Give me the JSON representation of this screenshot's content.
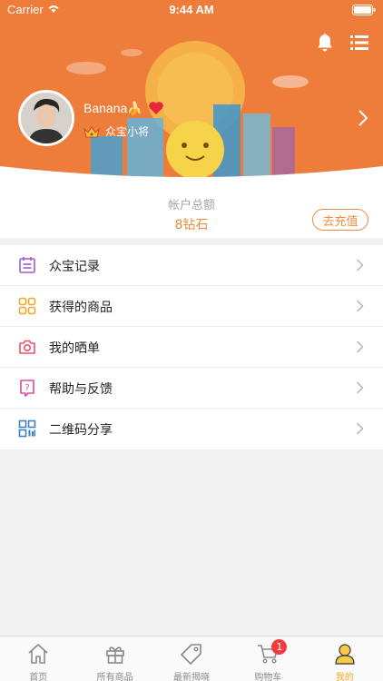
{
  "status_bar": {
    "carrier": "Carrier",
    "time": "9:44 AM"
  },
  "profile": {
    "username": "Banana🍌",
    "rank": "众宝小将"
  },
  "account": {
    "label": "帐户总额",
    "value": "8钻石",
    "recharge_label": "去充值"
  },
  "menu": {
    "items": [
      {
        "label": "众宝记录",
        "icon": "calendar-icon",
        "color": "#a259d9"
      },
      {
        "label": "获得的商品",
        "icon": "grid-icon",
        "color": "#f5a623"
      },
      {
        "label": "我的晒单",
        "icon": "camera-icon",
        "color": "#f0506e"
      },
      {
        "label": "帮助与反馈",
        "icon": "help-icon",
        "color": "#d94b9c"
      },
      {
        "label": "二维码分享",
        "icon": "qrcode-icon",
        "color": "#3b82c4"
      }
    ]
  },
  "tabbar": {
    "tabs": [
      {
        "label": "首页",
        "icon": "home-icon"
      },
      {
        "label": "所有商品",
        "icon": "gift-icon"
      },
      {
        "label": "最新揭晓",
        "icon": "tag-icon"
      },
      {
        "label": "购物车",
        "icon": "cart-icon",
        "badge": "1"
      },
      {
        "label": "我的",
        "icon": "user-icon",
        "active": true
      }
    ]
  },
  "colors": {
    "accent": "#f08c3c",
    "header": "#ee7d3b",
    "tab_active": "#f5a623"
  }
}
